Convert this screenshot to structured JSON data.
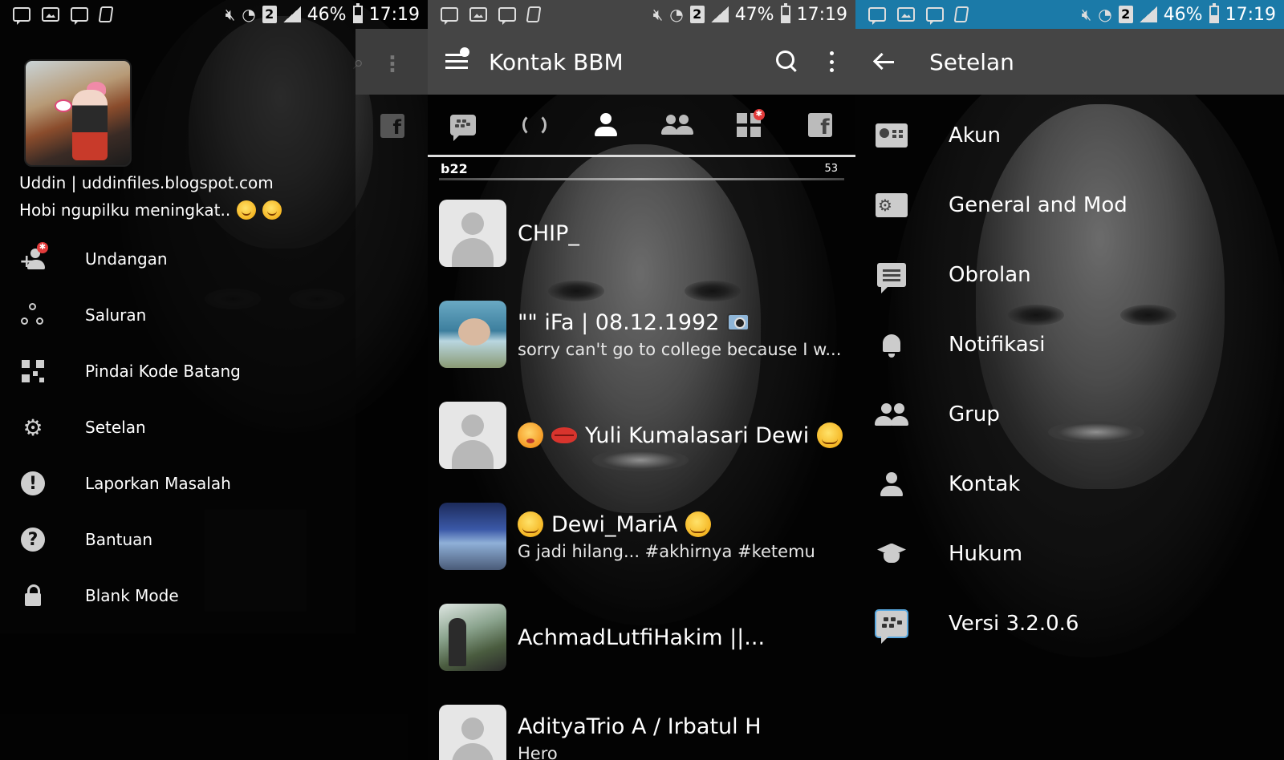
{
  "colors": {
    "appbar": "#454545",
    "statusbar_accent": "#1b7aa8",
    "badge": "#e23b3b",
    "text": "#ffffff"
  },
  "panel1": {
    "status": {
      "battery": "46%",
      "time": "17:19",
      "sim": "2"
    },
    "profile": {
      "name": "Uddin | uddinfiles.blogspot.com",
      "status": "Hobi ngupilku meningkat.."
    },
    "menu": [
      {
        "label": "Undangan",
        "icon": "add-contact-icon"
      },
      {
        "label": "Saluran",
        "icon": "channels-icon"
      },
      {
        "label": "Pindai Kode Batang",
        "icon": "qr-code-icon"
      },
      {
        "label": "Setelan",
        "icon": "gear-icon"
      },
      {
        "label": "Laporkan Masalah",
        "icon": "report-icon"
      },
      {
        "label": "Bantuan",
        "icon": "help-icon"
      },
      {
        "label": "Blank Mode",
        "icon": "lock-icon"
      }
    ]
  },
  "panel2": {
    "status": {
      "battery": "47%",
      "time": "17:19",
      "sim": "2"
    },
    "title": "Kontak BBM",
    "tabs": [
      {
        "name": "chats",
        "icon": "bbm-chat-icon"
      },
      {
        "name": "updates",
        "icon": "sync-icon"
      },
      {
        "name": "contacts",
        "icon": "person-icon",
        "active": true
      },
      {
        "name": "groups",
        "icon": "groups-icon"
      },
      {
        "name": "apps",
        "icon": "apps-grid-icon"
      },
      {
        "name": "facebook",
        "icon": "facebook-icon"
      }
    ],
    "group": {
      "label": "b22",
      "count": "53"
    },
    "contacts": [
      {
        "name": "CHIP_",
        "message": ""
      },
      {
        "name": "\"\" iFa | 08.12.1992",
        "message": "sorry can't go to college because I w..."
      },
      {
        "name": "Yuli Kumalasari Dewi",
        "message": ""
      },
      {
        "name": "Dewi_MariA",
        "message": "G jadi hilang... #akhirnya #ketemu"
      },
      {
        "name": "AchmadLutfiHakim ||...",
        "message": ""
      },
      {
        "name": "AdityaTrio A / Irbatul H",
        "message": "Hero"
      }
    ]
  },
  "panel3": {
    "status": {
      "battery": "46%",
      "time": "17:19",
      "sim": "2"
    },
    "title": "Setelan",
    "items": [
      {
        "label": "Akun",
        "icon": "account-card-icon"
      },
      {
        "label": "General and Mod",
        "icon": "settings-card-icon"
      },
      {
        "label": "Obrolan",
        "icon": "chat-icon"
      },
      {
        "label": "Notifikasi",
        "icon": "bell-icon"
      },
      {
        "label": "Grup",
        "icon": "group-icon"
      },
      {
        "label": "Kontak",
        "icon": "contact-icon"
      },
      {
        "label": "Hukum",
        "icon": "legal-cap-icon"
      },
      {
        "label": "Versi 3.2.0.6",
        "icon": "bbm-version-icon"
      }
    ]
  }
}
